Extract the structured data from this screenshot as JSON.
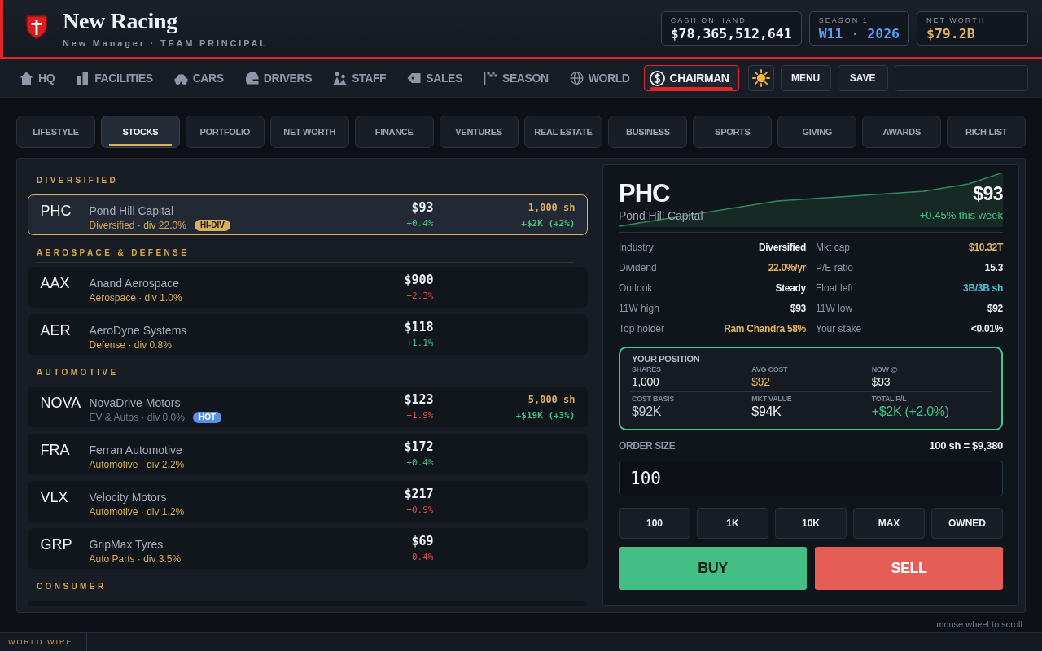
{
  "header": {
    "title": "New Racing",
    "subtitle": "New Manager · TEAM PRINCIPAL",
    "stats": [
      {
        "label": "CASH ON HAND",
        "value": "$78,365,512,641",
        "color": "#eef1f5"
      },
      {
        "label": "SEASON 1",
        "value": "W11 · 2026",
        "color": "#5b9cf0"
      },
      {
        "label": "NET WORTH",
        "value": "$79.2B",
        "color": "#e0b45e"
      }
    ]
  },
  "nav": {
    "items": [
      {
        "label": "HQ",
        "kind": "home",
        "selected": false
      },
      {
        "label": "FACILITIES",
        "kind": "facilities",
        "selected": false
      },
      {
        "label": "CARS",
        "kind": "cars",
        "selected": false
      },
      {
        "label": "DRIVERS",
        "kind": "drivers",
        "selected": false
      },
      {
        "label": "STAFF",
        "kind": "staff",
        "selected": false
      },
      {
        "label": "SALES",
        "kind": "sales",
        "selected": false
      },
      {
        "label": "SEASON",
        "kind": "season",
        "selected": false
      },
      {
        "label": "WORLD",
        "kind": "world",
        "selected": false
      },
      {
        "label": "CHAIRMAN",
        "kind": "chairman",
        "selected": true
      }
    ],
    "buttons": [
      "MENU",
      "SAVE"
    ]
  },
  "tabs": [
    {
      "label": "LIFESTYLE",
      "selected": false
    },
    {
      "label": "STOCKS",
      "selected": true
    },
    {
      "label": "PORTFOLIO",
      "selected": false
    },
    {
      "label": "NET WORTH",
      "selected": false
    },
    {
      "label": "FINANCE",
      "selected": false
    },
    {
      "label": "VENTURES",
      "selected": false
    },
    {
      "label": "REAL ESTATE",
      "selected": false
    },
    {
      "label": "BUSINESS",
      "selected": false
    },
    {
      "label": "SPORTS",
      "selected": false
    },
    {
      "label": "GIVING",
      "selected": false
    },
    {
      "label": "AWARDS",
      "selected": false
    },
    {
      "label": "RICH LIST",
      "selected": false
    }
  ],
  "stocks": [
    {
      "title": "DIVERSIFIED",
      "rows": [
        {
          "ticker": "PHC",
          "name": "Pond Hill Capital",
          "sub": "Diversified · div 22.0%",
          "muted": false,
          "badge": {
            "label": "HI-DIV",
            "kind": "dividend"
          },
          "price": "$93",
          "change": "+0.4%",
          "gain": true,
          "holding": {
            "shares": "1,000 sh",
            "pl": "+$2K (+2%)",
            "gain": true
          },
          "selected": true
        }
      ]
    },
    {
      "title": "AEROSPACE & DEFENSE",
      "rows": [
        {
          "ticker": "AAX",
          "name": "Anand Aerospace",
          "sub": "Aerospace · div 1.0%",
          "muted": false,
          "price": "$900",
          "change": "−2.3%",
          "gain": false,
          "selected": false
        },
        {
          "ticker": "AER",
          "name": "AeroDyne Systems",
          "sub": "Defense · div 0.8%",
          "muted": false,
          "price": "$118",
          "change": "+1.1%",
          "gain": true,
          "selected": false
        }
      ]
    },
    {
      "title": "AUTOMOTIVE",
      "rows": [
        {
          "ticker": "NOVA",
          "name": "NovaDrive Motors",
          "sub": "EV & Autos · div 0.0%",
          "muted": true,
          "badge": {
            "label": "HOT",
            "kind": "hot"
          },
          "price": "$123",
          "change": "−1.9%",
          "gain": false,
          "holding": {
            "shares": "5,000 sh",
            "pl": "+$19K (+3%)",
            "gain": true
          },
          "selected": false
        },
        {
          "ticker": "FRA",
          "name": "Ferran Automotive",
          "sub": "Automotive · div 2.2%",
          "muted": false,
          "price": "$172",
          "change": "+0.4%",
          "gain": true,
          "selected": false
        },
        {
          "ticker": "VLX",
          "name": "Velocity Motors",
          "sub": "Automotive · div 1.2%",
          "muted": false,
          "price": "$217",
          "change": "−0.9%",
          "gain": false,
          "selected": false
        },
        {
          "ticker": "GRP",
          "name": "GripMax Tyres",
          "sub": "Auto Parts · div 3.5%",
          "muted": false,
          "price": "$69",
          "change": "−0.4%",
          "gain": false,
          "selected": false
        }
      ]
    },
    {
      "title": "CONSUMER"
    }
  ],
  "detail": {
    "ticker": "PHC",
    "price": "$93",
    "name": "Pond Hill Capital",
    "change": "+0.45% this week",
    "gain": true,
    "stats": [
      {
        "label": "Industry",
        "value": "Diversified",
        "color": "#f1f3f6"
      },
      {
        "label": "Mkt cap",
        "value": "$10.32T",
        "color": "#e0b45e"
      },
      {
        "label": "Dividend",
        "value": "22.0%/yr",
        "color": "#e0b45e"
      },
      {
        "label": "P/E ratio",
        "value": "15.3",
        "color": "#f1f3f6"
      },
      {
        "label": "Outlook",
        "value": "Steady",
        "color": "#f1f3f6"
      },
      {
        "label": "Float left",
        "value": "3B/3B sh",
        "color": "#4dbfd6"
      },
      {
        "label": "11W high",
        "value": "$93",
        "color": "#f1f3f6"
      },
      {
        "label": "11W low",
        "value": "$92",
        "color": "#f1f3f6"
      },
      {
        "label": "Top holder",
        "value": "Ram Chandra 58%",
        "color": "#e0b45e"
      },
      {
        "label": "Your stake",
        "value": "<0.01%",
        "color": "#f1f3f6"
      }
    ],
    "position": {
      "title": "YOUR POSITION",
      "rows": [
        [
          {
            "label": "SHARES",
            "value": "1,000",
            "color": "#f1f3f6"
          },
          {
            "label": "AVG COST",
            "value": "$92",
            "color": "#e0b45e"
          },
          {
            "label": "NOW @",
            "value": "$93",
            "color": "#f1f3f6"
          }
        ],
        [
          {
            "label": "COST BASIS",
            "value": "$92K",
            "color": "#c4cad4"
          },
          {
            "label": "MKT VALUE",
            "value": "$94K",
            "color": "#f1f3f6"
          },
          {
            "label": "TOTAL P/L",
            "value": "+$2K (+2.0%)",
            "color": "#3ec486"
          }
        ]
      ]
    },
    "order": {
      "label": "ORDER SIZE",
      "summary": "100 sh = $9,380",
      "value": "100",
      "presets": [
        "100",
        "1K",
        "10K",
        "MAX",
        "OWNED"
      ],
      "buy": "BUY",
      "sell": "SELL"
    }
  },
  "hint": "mouse wheel to scroll",
  "ticker_bar": {
    "label": "WORLD WIRE"
  }
}
